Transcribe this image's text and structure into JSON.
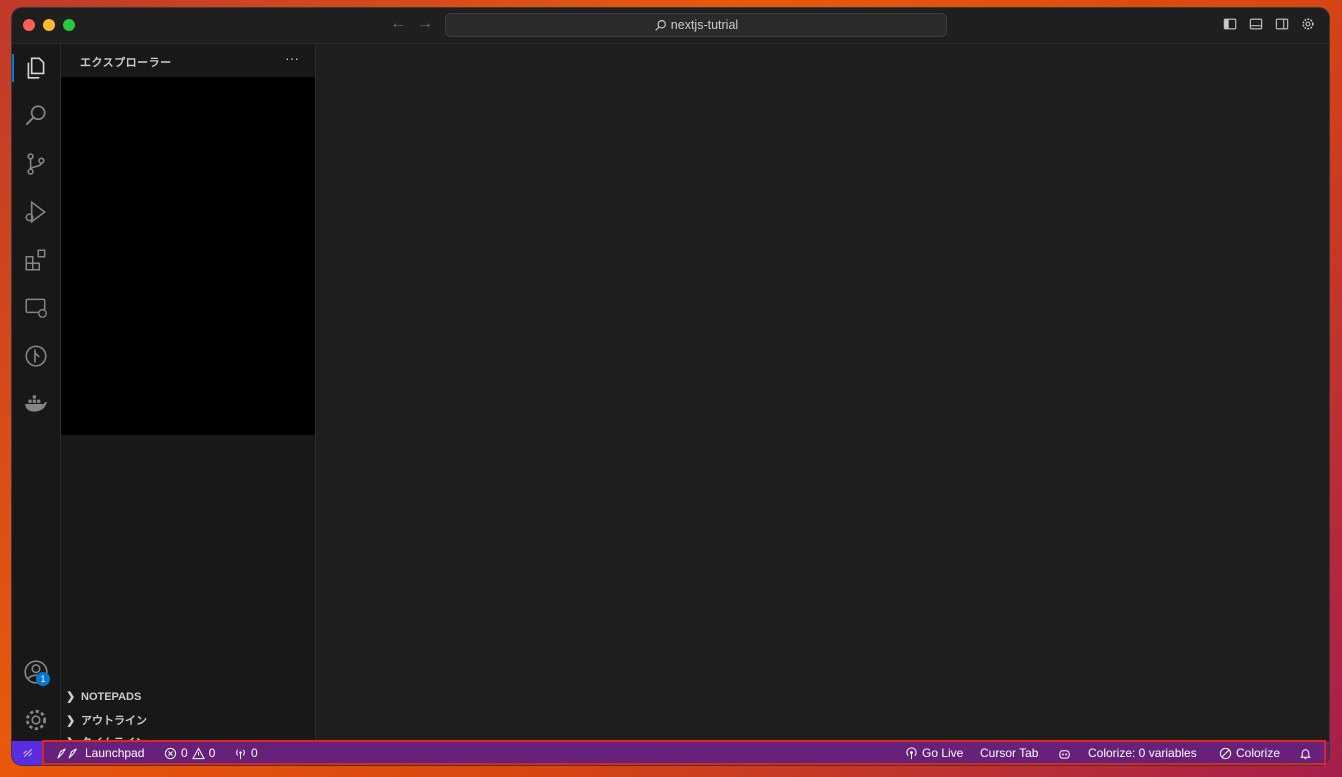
{
  "titlebar": {
    "search_text": "nextjs-tutrial",
    "back_icon": "arrow-left-icon",
    "forward_icon": "arrow-right-icon"
  },
  "activity": {
    "items": [
      "explorer-icon",
      "search-icon",
      "source-control-icon",
      "run-debug-icon",
      "extensions-icon",
      "remote-explorer-icon",
      "git-graph-icon",
      "docker-icon"
    ],
    "account_badge": "1"
  },
  "sidebar": {
    "title": "エクスプローラー",
    "more": "···",
    "sections": [
      "NOTEPADS",
      "アウトライン",
      "タイムライン"
    ]
  },
  "statusbar": {
    "launchpad": "Launchpad",
    "errors": "0",
    "warnings": "0",
    "ports": "0",
    "go_live": "Go Live",
    "cursor_tab": "Cursor Tab",
    "colorize_vars": "Colorize: 0 variables",
    "colorize": "Colorize"
  },
  "colors": {
    "status_bg": "#68217a",
    "remote_bg": "#5a2ee0",
    "accent": "#0078d4",
    "highlight_border": "#e0251b"
  }
}
